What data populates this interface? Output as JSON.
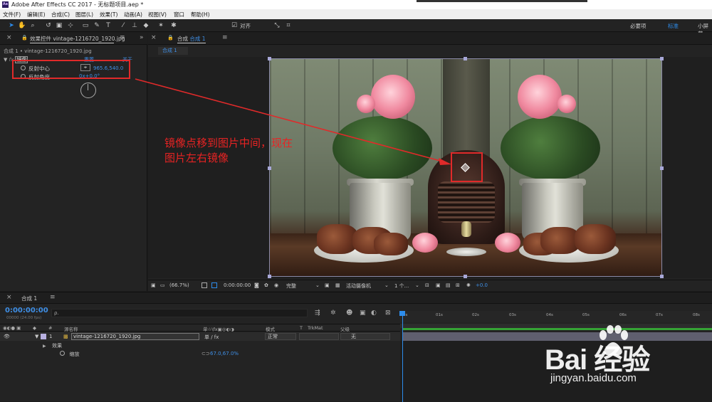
{
  "window": {
    "title": "Adobe After Effects CC 2017 - 无标题项目.aep *",
    "logo": "Ae"
  },
  "menu": [
    "文件(F)",
    "编辑(E)",
    "合成(C)",
    "图层(L)",
    "效果(T)",
    "动画(A)",
    "视图(V)",
    "窗口",
    "帮助(H)"
  ],
  "toolbar": {
    "snap_label": "对齐",
    "workspaces": [
      {
        "label": "必要项",
        "active": false
      },
      {
        "label": "标准",
        "active": true
      },
      {
        "label": "小屏幕",
        "active": false
      }
    ]
  },
  "effects_panel": {
    "tab_label": "效果控件 vintage-1216720_1920.jpg",
    "breadcrumb": "合成 1 • vintage-1216720_1920.jpg",
    "effect_name": "镜像",
    "reset_label": "重置",
    "about_label": "关于",
    "props": [
      {
        "label": "反射中心",
        "value": "965.6,540.0"
      },
      {
        "label": "反射角度",
        "value": "0x+0.0°"
      }
    ]
  },
  "comp_panel": {
    "tab_prefix": "合成",
    "tab_name": "合成 1",
    "subtab": "合成 1",
    "controls": {
      "zoom": "(66.7%)",
      "timecode": "0:00:00:00",
      "resolution": "完整",
      "camera": "活动摄像机",
      "views": "1 个...",
      "exposure": "+0.0"
    }
  },
  "annotation": {
    "line1": "镜像点移到图片中间，现在",
    "line2": "图片左右镜像",
    "color": "#e82323"
  },
  "timeline": {
    "tab_label": "合成 1",
    "timecode": "0:00:00:00",
    "fps": "00000 (24.00 fps)",
    "search_placeholder": "ρ.",
    "columns": {
      "num": "#",
      "source_name": "源名称",
      "switches": "单☆\\fx▣◎◐◑",
      "mode": "模式",
      "t": "T",
      "trkmat": "TrkMat",
      "parent": "父级"
    },
    "layer": {
      "index": "1",
      "name": "vintage-1216720_1920.jpg",
      "mode": "正常",
      "parent": "无"
    },
    "effects_group": "效果",
    "scale_label": "缩放",
    "scale_value": "67.0,67.0%",
    "ruler": [
      "0s",
      "01s",
      "02s",
      "03s",
      "04s",
      "05s",
      "06s",
      "07s",
      "08s"
    ]
  },
  "watermark": {
    "brand": "Bai 经验",
    "sub": "jingyan.baidu.com"
  },
  "colors": {
    "accent": "#2d8ceb",
    "highlight": "#e02a2a",
    "panel": "#232323"
  }
}
